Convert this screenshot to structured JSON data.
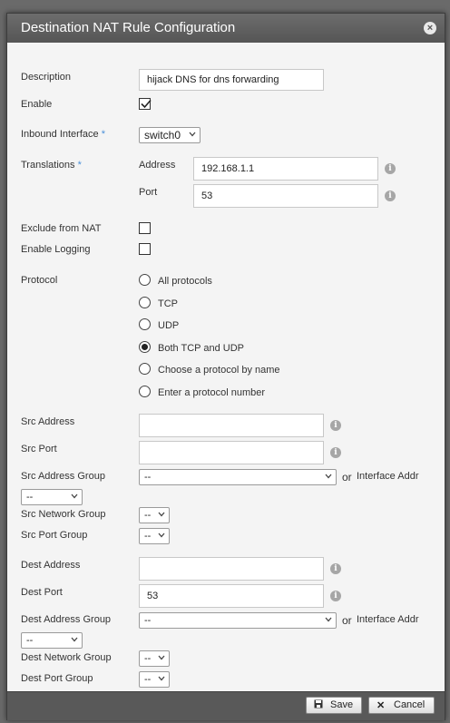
{
  "dialog": {
    "title": "Destination NAT Rule Configuration",
    "close_glyph": "×"
  },
  "form": {
    "description": {
      "label": "Description",
      "value": "hijack DNS for dns forwarding"
    },
    "enable": {
      "label": "Enable",
      "checked": true
    },
    "inbound_interface": {
      "label": "Inbound Interface",
      "required_mark": "*",
      "value": "switch0"
    },
    "translations": {
      "label": "Translations",
      "required_mark": "*",
      "address_label": "Address",
      "address_value": "192.168.1.1",
      "port_label": "Port",
      "port_value": "53"
    },
    "exclude_from_nat": {
      "label": "Exclude from NAT",
      "checked": false
    },
    "enable_logging": {
      "label": "Enable Logging",
      "checked": false
    },
    "protocol": {
      "label": "Protocol",
      "options": [
        "All protocols",
        "TCP",
        "UDP",
        "Both TCP and UDP",
        "Choose a protocol by name",
        "Enter a protocol number"
      ],
      "selected_index": 3
    },
    "src_address": {
      "label": "Src Address",
      "value": ""
    },
    "src_port": {
      "label": "Src Port",
      "value": ""
    },
    "src_address_group": {
      "label": "Src Address Group",
      "value": "--",
      "or_text": "or",
      "interface_addr": "Interface Addr",
      "interface_value": "--"
    },
    "src_network_group": {
      "label": "Src Network Group",
      "value": "--"
    },
    "src_port_group": {
      "label": "Src Port Group",
      "value": "--"
    },
    "dest_address": {
      "label": "Dest Address",
      "value": ""
    },
    "dest_port": {
      "label": "Dest Port",
      "value": "53"
    },
    "dest_address_group": {
      "label": "Dest Address Group",
      "value": "--",
      "or_text": "or",
      "interface_addr": "Interface Addr",
      "interface_value": "--"
    },
    "dest_network_group": {
      "label": "Dest Network Group",
      "value": "--"
    },
    "dest_port_group": {
      "label": "Dest Port Group",
      "value": "--"
    }
  },
  "info_glyph": "i",
  "footer": {
    "save_label": "Save",
    "cancel_label": "Cancel",
    "save_icon": "save-icon",
    "cancel_icon": "cancel-icon"
  },
  "colors": {
    "titlebar": "#5f5f5f",
    "dialog_bg": "#f4f4f4",
    "required_mark": "#4a90d9",
    "footer": "#595959"
  }
}
